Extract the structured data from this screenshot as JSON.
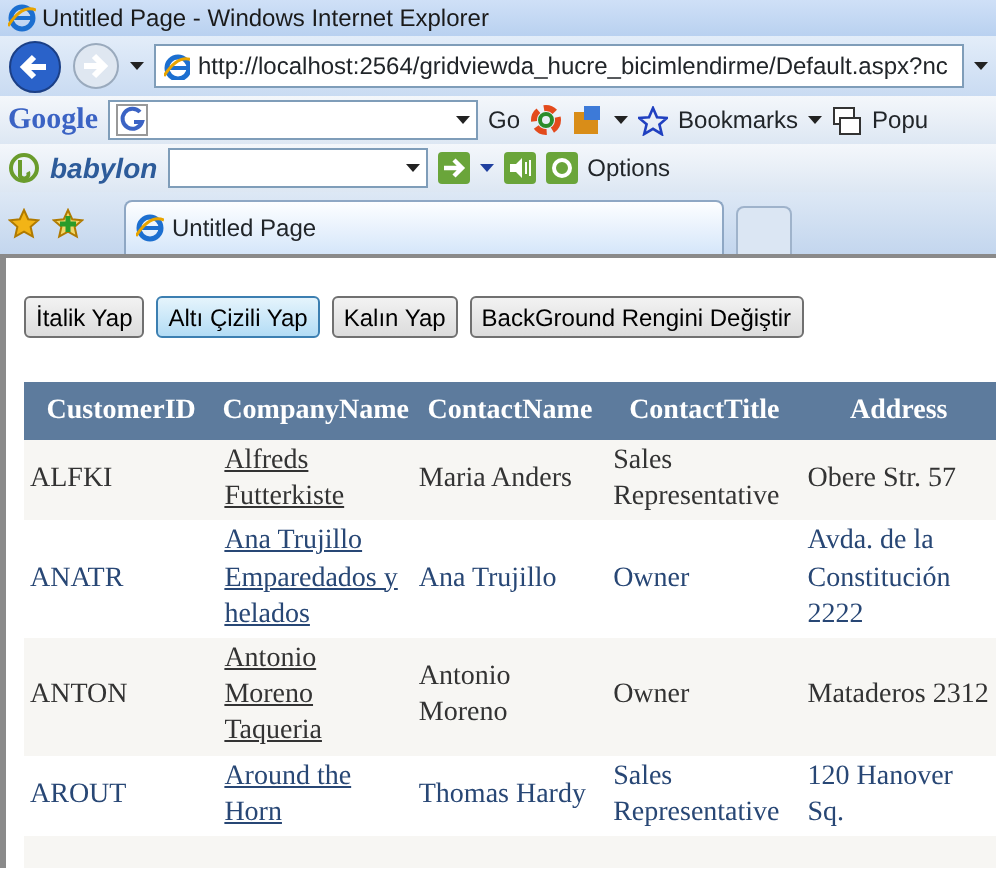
{
  "window": {
    "title": "Untitled Page - Windows Internet Explorer"
  },
  "address_bar": {
    "url": "http://localhost:2564/gridviewda_hucre_bicimlendirme/Default.aspx?nc"
  },
  "google_toolbar": {
    "logo": "Google",
    "go": "Go",
    "bookmarks": "Bookmarks",
    "popups": "Popu"
  },
  "babylon_toolbar": {
    "logo": "babylon",
    "options": "Options"
  },
  "tabs": [
    {
      "label": "Untitled Page",
      "selected": true
    }
  ],
  "buttons": [
    {
      "label": "İtalik Yap",
      "selected": false
    },
    {
      "label": "Altı Çizili Yap",
      "selected": true
    },
    {
      "label": "Kalın Yap",
      "selected": false
    },
    {
      "label": "BackGround Rengini Değiştir",
      "selected": false
    }
  ],
  "table": {
    "columns": [
      "CustomerID",
      "CompanyName",
      "ContactName",
      "ContactTitle",
      "Address"
    ],
    "rows": [
      [
        "ALFKI",
        "Alfreds Futterkiste",
        "Maria Anders",
        "Sales Representative",
        "Obere Str. 57"
      ],
      [
        "ANATR",
        "Ana Trujillo Emparedados y helados",
        "Ana Trujillo",
        "Owner",
        "Avda. de la Constitución 2222"
      ],
      [
        "ANTON",
        "Antonio Moreno Taqueria",
        "Antonio Moreno",
        "Owner",
        "Mataderos 2312"
      ],
      [
        "AROUT",
        "Around the Horn",
        "Thomas Hardy",
        "Sales Representative",
        "120 Hanover Sq."
      ]
    ]
  }
}
